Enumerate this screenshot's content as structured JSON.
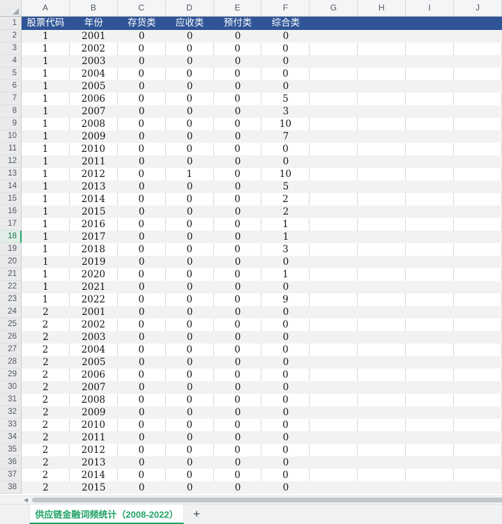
{
  "colors": {
    "header_blue": "#2F5597",
    "band_gray": "#F2F2F2",
    "tab_green": "#21A366",
    "selected_row_green": "#21A366",
    "selected_row_bg": "#DFEFE7"
  },
  "grid": {
    "column_letters": [
      "A",
      "B",
      "C",
      "D",
      "E",
      "F",
      "G",
      "H",
      "I",
      "J"
    ],
    "selected_row": 18,
    "header_row": {
      "n": "1",
      "cells": [
        "股票代码",
        "年份",
        "存货类",
        "应收类",
        "预付类",
        "综合类",
        "",
        "",
        "",
        ""
      ]
    },
    "rows": [
      {
        "n": 2,
        "values": [
          "1",
          "2001",
          "0",
          "0",
          "0",
          "0"
        ]
      },
      {
        "n": 3,
        "values": [
          "1",
          "2002",
          "0",
          "0",
          "0",
          "0"
        ]
      },
      {
        "n": 4,
        "values": [
          "1",
          "2003",
          "0",
          "0",
          "0",
          "0"
        ]
      },
      {
        "n": 5,
        "values": [
          "1",
          "2004",
          "0",
          "0",
          "0",
          "0"
        ]
      },
      {
        "n": 6,
        "values": [
          "1",
          "2005",
          "0",
          "0",
          "0",
          "0"
        ]
      },
      {
        "n": 7,
        "values": [
          "1",
          "2006",
          "0",
          "0",
          "0",
          "5"
        ]
      },
      {
        "n": 8,
        "values": [
          "1",
          "2007",
          "0",
          "0",
          "0",
          "3"
        ]
      },
      {
        "n": 9,
        "values": [
          "1",
          "2008",
          "0",
          "0",
          "0",
          "10"
        ]
      },
      {
        "n": 10,
        "values": [
          "1",
          "2009",
          "0",
          "0",
          "0",
          "7"
        ]
      },
      {
        "n": 11,
        "values": [
          "1",
          "2010",
          "0",
          "0",
          "0",
          "0"
        ]
      },
      {
        "n": 12,
        "values": [
          "1",
          "2011",
          "0",
          "0",
          "0",
          "0"
        ]
      },
      {
        "n": 13,
        "values": [
          "1",
          "2012",
          "0",
          "1",
          "0",
          "10"
        ]
      },
      {
        "n": 14,
        "values": [
          "1",
          "2013",
          "0",
          "0",
          "0",
          "5"
        ]
      },
      {
        "n": 15,
        "values": [
          "1",
          "2014",
          "0",
          "0",
          "0",
          "2"
        ]
      },
      {
        "n": 16,
        "values": [
          "1",
          "2015",
          "0",
          "0",
          "0",
          "2"
        ]
      },
      {
        "n": 17,
        "values": [
          "1",
          "2016",
          "0",
          "0",
          "0",
          "1"
        ]
      },
      {
        "n": 18,
        "values": [
          "1",
          "2017",
          "0",
          "0",
          "0",
          "1"
        ]
      },
      {
        "n": 19,
        "values": [
          "1",
          "2018",
          "0",
          "0",
          "0",
          "3"
        ]
      },
      {
        "n": 20,
        "values": [
          "1",
          "2019",
          "0",
          "0",
          "0",
          "0"
        ]
      },
      {
        "n": 21,
        "values": [
          "1",
          "2020",
          "0",
          "0",
          "0",
          "1"
        ]
      },
      {
        "n": 22,
        "values": [
          "1",
          "2021",
          "0",
          "0",
          "0",
          "0"
        ]
      },
      {
        "n": 23,
        "values": [
          "1",
          "2022",
          "0",
          "0",
          "0",
          "9"
        ]
      },
      {
        "n": 24,
        "values": [
          "2",
          "2001",
          "0",
          "0",
          "0",
          "0"
        ]
      },
      {
        "n": 25,
        "values": [
          "2",
          "2002",
          "0",
          "0",
          "0",
          "0"
        ]
      },
      {
        "n": 26,
        "values": [
          "2",
          "2003",
          "0",
          "0",
          "0",
          "0"
        ]
      },
      {
        "n": 27,
        "values": [
          "2",
          "2004",
          "0",
          "0",
          "0",
          "0"
        ]
      },
      {
        "n": 28,
        "values": [
          "2",
          "2005",
          "0",
          "0",
          "0",
          "0"
        ]
      },
      {
        "n": 29,
        "values": [
          "2",
          "2006",
          "0",
          "0",
          "0",
          "0"
        ]
      },
      {
        "n": 30,
        "values": [
          "2",
          "2007",
          "0",
          "0",
          "0",
          "0"
        ]
      },
      {
        "n": 31,
        "values": [
          "2",
          "2008",
          "0",
          "0",
          "0",
          "0"
        ]
      },
      {
        "n": 32,
        "values": [
          "2",
          "2009",
          "0",
          "0",
          "0",
          "0"
        ]
      },
      {
        "n": 33,
        "values": [
          "2",
          "2010",
          "0",
          "0",
          "0",
          "0"
        ]
      },
      {
        "n": 34,
        "values": [
          "2",
          "2011",
          "0",
          "0",
          "0",
          "0"
        ]
      },
      {
        "n": 35,
        "values": [
          "2",
          "2012",
          "0",
          "0",
          "0",
          "0"
        ]
      },
      {
        "n": 36,
        "values": [
          "2",
          "2013",
          "0",
          "0",
          "0",
          "0"
        ]
      },
      {
        "n": 37,
        "values": [
          "2",
          "2014",
          "0",
          "0",
          "0",
          "0"
        ]
      },
      {
        "n": 38,
        "values": [
          "2",
          "2015",
          "0",
          "0",
          "0",
          "0"
        ]
      }
    ]
  },
  "scrollbar": {
    "left_arrow_glyph": "◀"
  },
  "sheet_tabs": {
    "active_label": "供应链金融词频统计（2008-2022）",
    "add_label": "+"
  }
}
